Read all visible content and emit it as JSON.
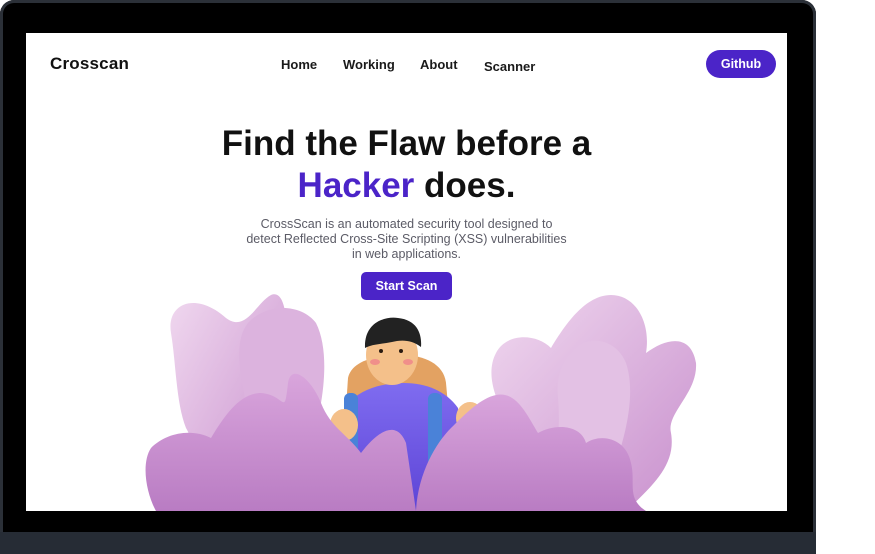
{
  "brand": {
    "name": "Crosscan"
  },
  "nav": {
    "items": [
      {
        "label": "Home"
      },
      {
        "label": "Working"
      },
      {
        "label": "About"
      },
      {
        "label": "Scanner"
      }
    ],
    "github_label": "Github"
  },
  "hero": {
    "title_line1": "Find the Flaw before a",
    "title_accent": "Hacker",
    "title_end": " does.",
    "description": "CrossScan is an automated security tool designed to detect Reflected Cross-Site Scripting (XSS) vulnerabilities in web applications.",
    "cta_label": "Start Scan"
  },
  "colors": {
    "accent": "#4b24c8",
    "frame": "#000000",
    "blob_pink": "#d49ad8",
    "blob_light": "#e6c4e6"
  }
}
